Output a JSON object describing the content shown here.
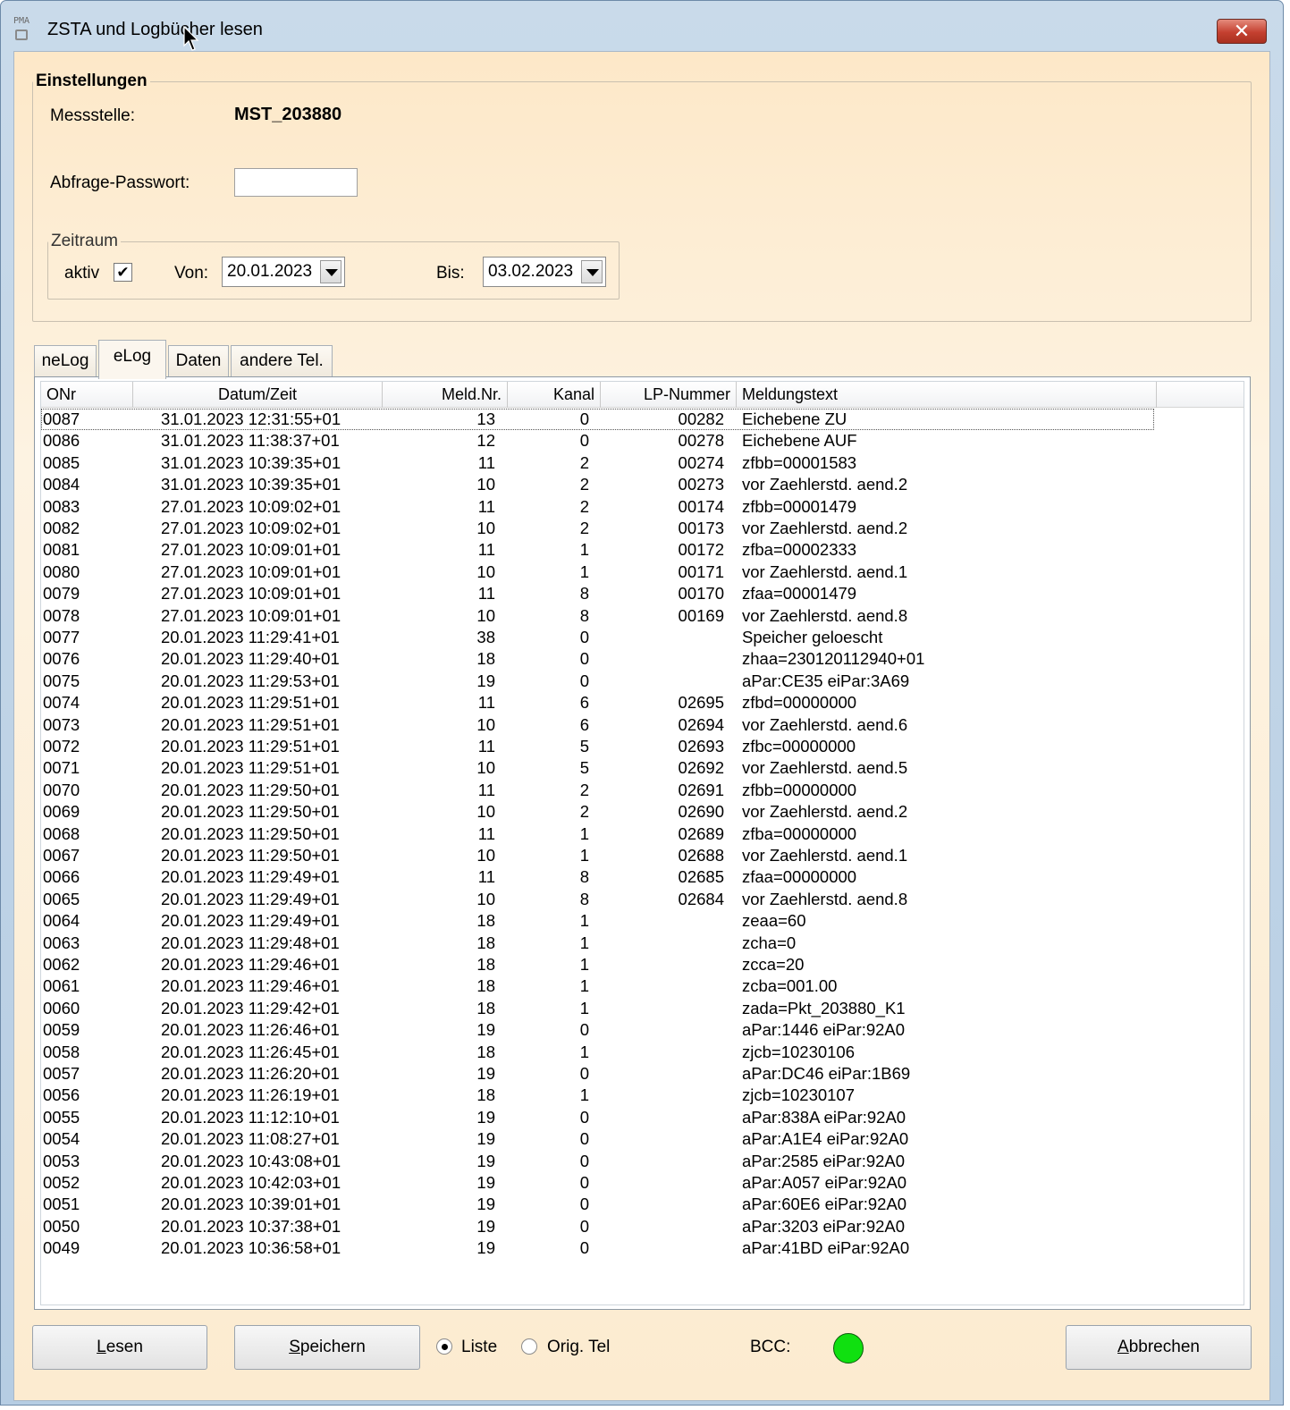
{
  "window": {
    "title": "ZSTA und Logbücher lesen",
    "app_icon_text": "PMA",
    "close_symbol": "✕"
  },
  "settings": {
    "group_title": "Einstellungen",
    "messstelle_label": "Messstelle:",
    "messstelle_value": "MST_203880",
    "password_label": "Abfrage-Passwort:",
    "password_value": ""
  },
  "zeitraum": {
    "title": "Zeitraum",
    "aktiv_label": "aktiv",
    "aktiv_checked": true,
    "check_symbol": "✔",
    "von_label": "Von:",
    "von_value": "20.01.2023",
    "bis_label": "Bis:",
    "bis_value": "03.02.2023"
  },
  "tabs": [
    "neLog",
    "eLog",
    "Daten",
    "andere Tel."
  ],
  "active_tab": "eLog",
  "table": {
    "columns": [
      "ONr",
      "Datum/Zeit",
      "Meld.Nr.",
      "Kanal",
      "LP-Nummer",
      "Meldungstext"
    ],
    "rows": [
      [
        "0087",
        "31.01.2023  12:31:55+01",
        "13",
        "0",
        "00282",
        "Eichebene ZU"
      ],
      [
        "0086",
        "31.01.2023  11:38:37+01",
        "12",
        "0",
        "00278",
        "Eichebene AUF"
      ],
      [
        "0085",
        "31.01.2023  10:39:35+01",
        "11",
        "2",
        "00274",
        "zfbb=00001583"
      ],
      [
        "0084",
        "31.01.2023  10:39:35+01",
        "10",
        "2",
        "00273",
        "vor Zaehlerstd. aend.2"
      ],
      [
        "0083",
        "27.01.2023  10:09:02+01",
        "11",
        "2",
        "00174",
        "zfbb=00001479"
      ],
      [
        "0082",
        "27.01.2023  10:09:02+01",
        "10",
        "2",
        "00173",
        "vor Zaehlerstd. aend.2"
      ],
      [
        "0081",
        "27.01.2023  10:09:01+01",
        "11",
        "1",
        "00172",
        "zfba=00002333"
      ],
      [
        "0080",
        "27.01.2023  10:09:01+01",
        "10",
        "1",
        "00171",
        "vor Zaehlerstd. aend.1"
      ],
      [
        "0079",
        "27.01.2023  10:09:01+01",
        "11",
        "8",
        "00170",
        "zfaa=00001479"
      ],
      [
        "0078",
        "27.01.2023  10:09:01+01",
        "10",
        "8",
        "00169",
        "vor Zaehlerstd. aend.8"
      ],
      [
        "0077",
        "20.01.2023  11:29:41+01",
        "38",
        "0",
        "",
        "Speicher geloescht"
      ],
      [
        "0076",
        "20.01.2023  11:29:40+01",
        "18",
        "0",
        "",
        "zhaa=230120112940+01"
      ],
      [
        "0075",
        "20.01.2023  11:29:53+01",
        "19",
        "0",
        "",
        "aPar:CE35 eiPar:3A69"
      ],
      [
        "0074",
        "20.01.2023  11:29:51+01",
        "11",
        "6",
        "02695",
        "zfbd=00000000"
      ],
      [
        "0073",
        "20.01.2023  11:29:51+01",
        "10",
        "6",
        "02694",
        "vor Zaehlerstd. aend.6"
      ],
      [
        "0072",
        "20.01.2023  11:29:51+01",
        "11",
        "5",
        "02693",
        "zfbc=00000000"
      ],
      [
        "0071",
        "20.01.2023  11:29:51+01",
        "10",
        "5",
        "02692",
        "vor Zaehlerstd. aend.5"
      ],
      [
        "0070",
        "20.01.2023  11:29:50+01",
        "11",
        "2",
        "02691",
        "zfbb=00000000"
      ],
      [
        "0069",
        "20.01.2023  11:29:50+01",
        "10",
        "2",
        "02690",
        "vor Zaehlerstd. aend.2"
      ],
      [
        "0068",
        "20.01.2023  11:29:50+01",
        "11",
        "1",
        "02689",
        "zfba=00000000"
      ],
      [
        "0067",
        "20.01.2023  11:29:50+01",
        "10",
        "1",
        "02688",
        "vor Zaehlerstd. aend.1"
      ],
      [
        "0066",
        "20.01.2023  11:29:49+01",
        "11",
        "8",
        "02685",
        "zfaa=00000000"
      ],
      [
        "0065",
        "20.01.2023  11:29:49+01",
        "10",
        "8",
        "02684",
        "vor Zaehlerstd. aend.8"
      ],
      [
        "0064",
        "20.01.2023  11:29:49+01",
        "18",
        "1",
        "",
        "zeaa=60"
      ],
      [
        "0063",
        "20.01.2023  11:29:48+01",
        "18",
        "1",
        "",
        "zcha=0"
      ],
      [
        "0062",
        "20.01.2023  11:29:46+01",
        "18",
        "1",
        "",
        "zcca=20"
      ],
      [
        "0061",
        "20.01.2023  11:29:46+01",
        "18",
        "1",
        "",
        "zcba=001.00"
      ],
      [
        "0060",
        "20.01.2023  11:29:42+01",
        "18",
        "1",
        "",
        "zada=Pkt_203880_K1"
      ],
      [
        "0059",
        "20.01.2023  11:26:46+01",
        "19",
        "0",
        "",
        "aPar:1446 eiPar:92A0"
      ],
      [
        "0058",
        "20.01.2023  11:26:45+01",
        "18",
        "1",
        "",
        "zjcb=10230106"
      ],
      [
        "0057",
        "20.01.2023  11:26:20+01",
        "19",
        "0",
        "",
        "aPar:DC46 eiPar:1B69"
      ],
      [
        "0056",
        "20.01.2023  11:26:19+01",
        "18",
        "1",
        "",
        "zjcb=10230107"
      ],
      [
        "0055",
        "20.01.2023  11:12:10+01",
        "19",
        "0",
        "",
        "aPar:838A eiPar:92A0"
      ],
      [
        "0054",
        "20.01.2023  11:08:27+01",
        "19",
        "0",
        "",
        "aPar:A1E4 eiPar:92A0"
      ],
      [
        "0053",
        "20.01.2023  10:43:08+01",
        "19",
        "0",
        "",
        "aPar:2585 eiPar:92A0"
      ],
      [
        "0052",
        "20.01.2023  10:42:03+01",
        "19",
        "0",
        "",
        "aPar:A057 eiPar:92A0"
      ],
      [
        "0051",
        "20.01.2023  10:39:01+01",
        "19",
        "0",
        "",
        "aPar:60E6 eiPar:92A0"
      ],
      [
        "0050",
        "20.01.2023  10:37:38+01",
        "19",
        "0",
        "",
        "aPar:3203 eiPar:92A0"
      ],
      [
        "0049",
        "20.01.2023  10:36:58+01",
        "19",
        "0",
        "",
        "aPar:41BD eiPar:92A0"
      ]
    ]
  },
  "footer": {
    "lesen_label": "Lesen",
    "speichern_label": "Speichern",
    "radio_liste_label": "Liste",
    "radio_origtel_label": "Orig. Tel",
    "selected_radio": "Liste",
    "bcc_label": "BCC:",
    "bcc_status_color": "#10e010",
    "abbrechen_label": "Abbrechen"
  }
}
